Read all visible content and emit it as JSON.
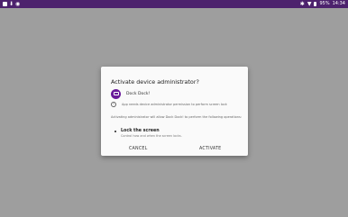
{
  "status_bar": {
    "time": "14:34",
    "battery": "95%",
    "left_icons": [
      "gallery-icon",
      "download-icon",
      "notification-icon"
    ],
    "right_icons": [
      "bluetooth-icon",
      "wifi-icon",
      "battery-icon"
    ],
    "background": "#4d226d"
  },
  "dialog": {
    "title": "Activate device administrator?",
    "app_name": "Dock Dock!",
    "app_icon": "dock-icon",
    "accent": "#6a1b9a",
    "info_text": "App needs device administrator permission to perform screen lock",
    "description": "Activating administrator will allow Dock Dock! to perform the following operations:",
    "permission": {
      "title": "Lock the screen",
      "description": "Control how and when the screen locks."
    },
    "buttons": {
      "cancel": "CANCEL",
      "activate": "ACTIVATE"
    }
  }
}
